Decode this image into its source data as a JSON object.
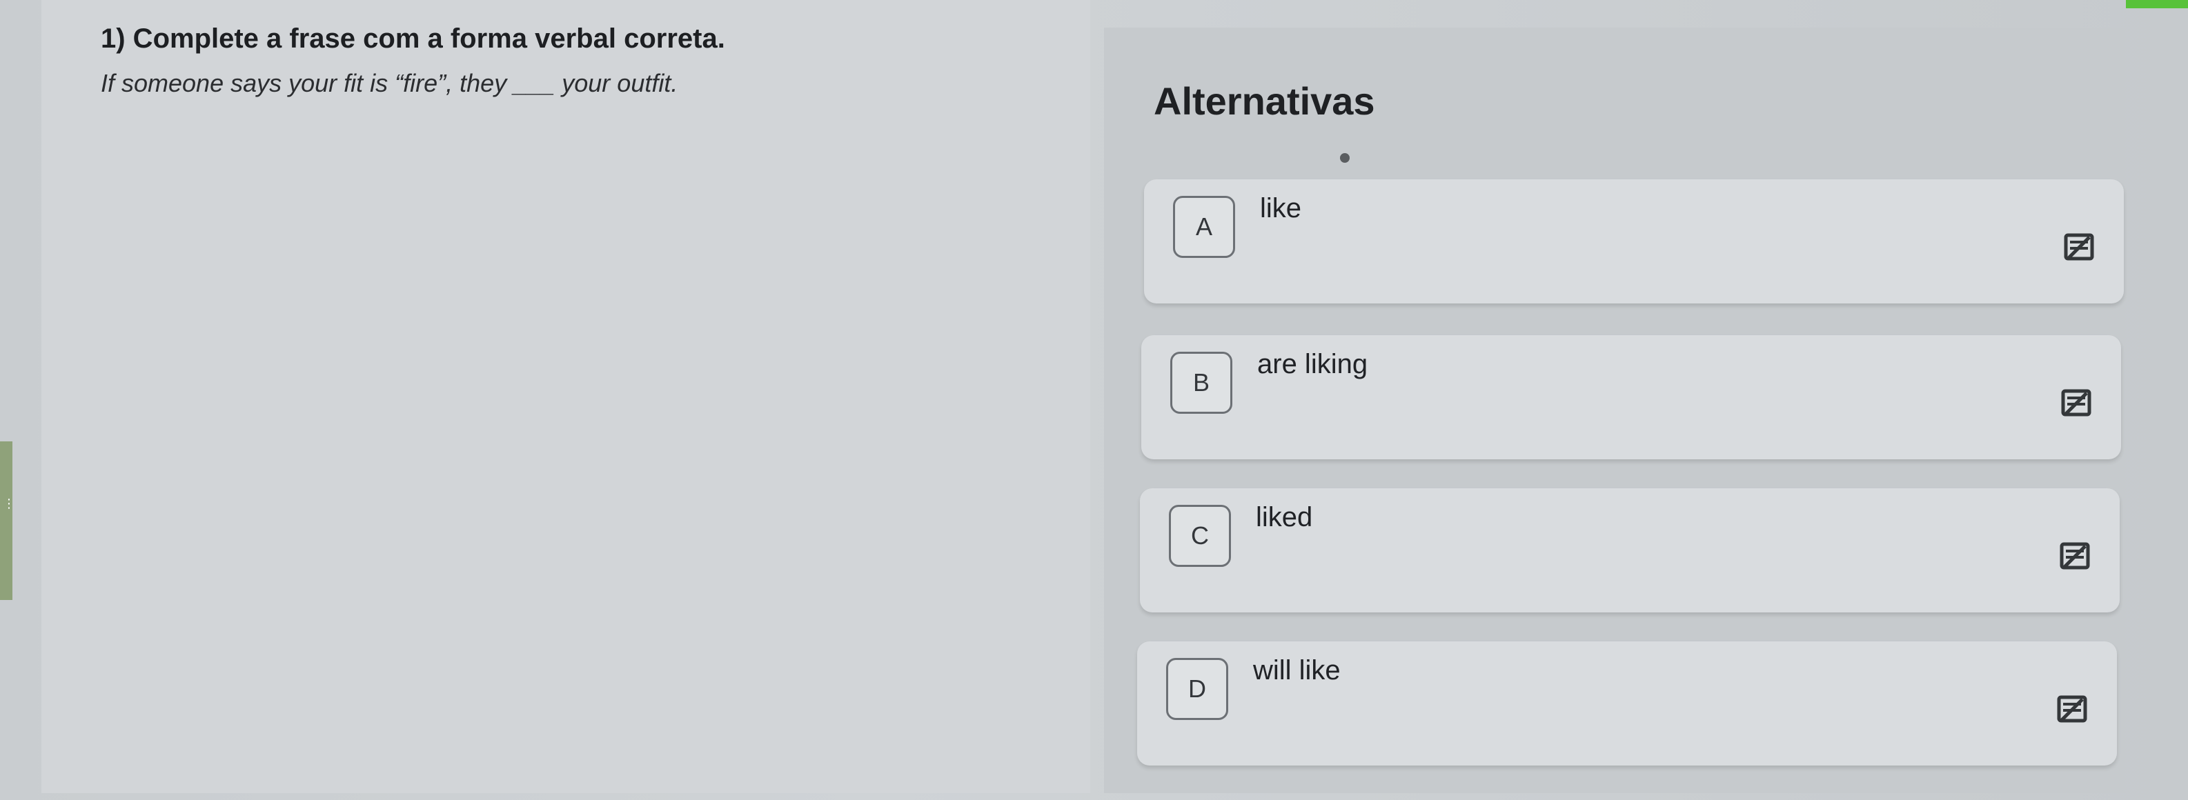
{
  "question": {
    "title": "1) Complete a frase com a forma verbal correta.",
    "text": "If someone says your fit is “fire”, they ___ your outfit."
  },
  "alternatives": {
    "heading": "Alternativas",
    "options": [
      {
        "letter": "A",
        "text": "like",
        "action_icon": "strikethrough-icon"
      },
      {
        "letter": "B",
        "text": "are liking",
        "action_icon": "strikethrough-icon"
      },
      {
        "letter": "C",
        "text": "liked",
        "action_icon": "strikethrough-icon"
      },
      {
        "letter": "D",
        "text": "will like",
        "action_icon": "strikethrough-icon"
      }
    ]
  },
  "colors": {
    "accent_green": "#58c23a",
    "card_background": "#d9dcdf",
    "page_background": "#c9cdd0"
  }
}
